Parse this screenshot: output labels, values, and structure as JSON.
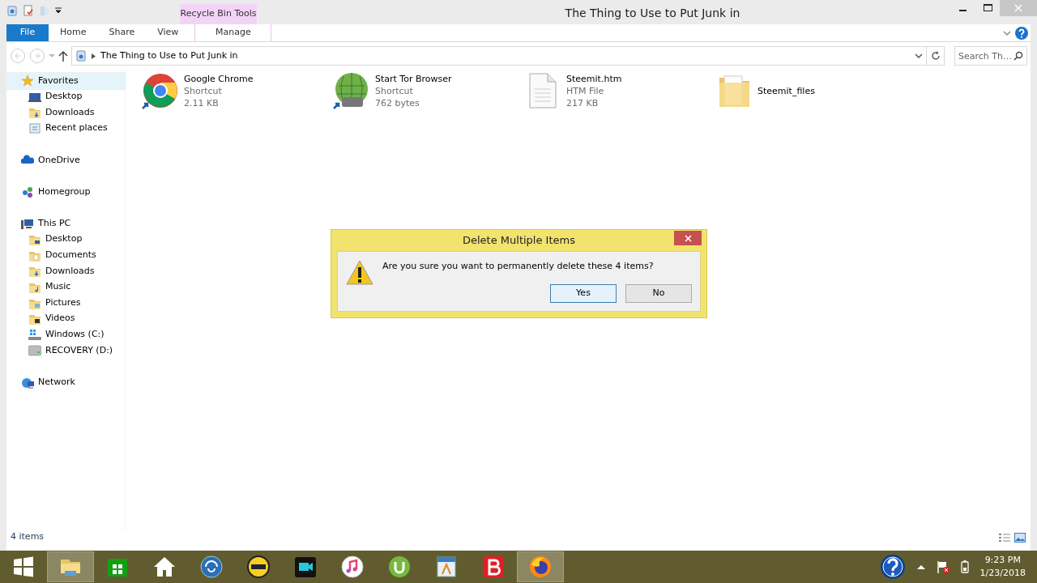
{
  "window": {
    "title": "The Thing to Use to Put Junk in"
  },
  "ribbon": {
    "context_label": "Recycle Bin Tools",
    "tabs": [
      {
        "label": "File",
        "kind": "file"
      },
      {
        "label": "Home",
        "kind": "normal"
      },
      {
        "label": "Share",
        "kind": "normal"
      },
      {
        "label": "View",
        "kind": "normal"
      },
      {
        "label": "Manage",
        "kind": "contextual"
      }
    ]
  },
  "address": {
    "path": "The Thing to Use to Put Junk in",
    "search_placeholder": "Search Th…"
  },
  "navigation": [
    {
      "label": "Favorites",
      "selected": true,
      "children": [
        {
          "label": "Desktop",
          "selected": false
        },
        {
          "label": "Downloads",
          "selected": false
        },
        {
          "label": "Recent places",
          "selected": false
        }
      ]
    },
    {
      "label": "OneDrive",
      "selected": false
    },
    {
      "label": "Homegroup",
      "selected": false
    },
    {
      "label": "This PC",
      "selected": false,
      "children": [
        {
          "label": "Desktop",
          "selected": false
        },
        {
          "label": "Documents",
          "selected": false
        },
        {
          "label": "Downloads",
          "selected": false
        },
        {
          "label": "Music",
          "selected": false
        },
        {
          "label": "Pictures",
          "selected": false
        },
        {
          "label": "Videos",
          "selected": false
        },
        {
          "label": "Windows (C:)",
          "selected": false
        },
        {
          "label": "RECOVERY (D:)",
          "selected": false
        }
      ]
    },
    {
      "label": "Network",
      "selected": false
    }
  ],
  "files": [
    {
      "name": "Google Chrome",
      "type": "Shortcut",
      "size": "2.11 KB"
    },
    {
      "name": "Start Tor Browser",
      "type": "Shortcut",
      "size": "762 bytes"
    },
    {
      "name": "Steemit.htm",
      "type": "HTM File",
      "size": "217 KB"
    },
    {
      "name": "Steemit_files"
    }
  ],
  "dialog": {
    "title": "Delete Multiple Items",
    "message": "Are you sure you want to permanently delete these 4 items?",
    "buttons": [
      {
        "label": "Yes",
        "selected": true
      },
      {
        "label": "No",
        "selected": false
      }
    ]
  },
  "status_bar": {
    "text": "4 items"
  },
  "taskbar": {
    "apps": [
      {
        "selected": true
      },
      {
        "selected": false
      },
      {
        "selected": false
      },
      {
        "selected": false
      },
      {
        "selected": false
      },
      {
        "selected": false
      },
      {
        "selected": false
      },
      {
        "selected": false
      },
      {
        "selected": false
      },
      {
        "selected": false
      },
      {
        "selected": true
      }
    ],
    "time": "9:23 PM",
    "date": "1/23/2018"
  }
}
